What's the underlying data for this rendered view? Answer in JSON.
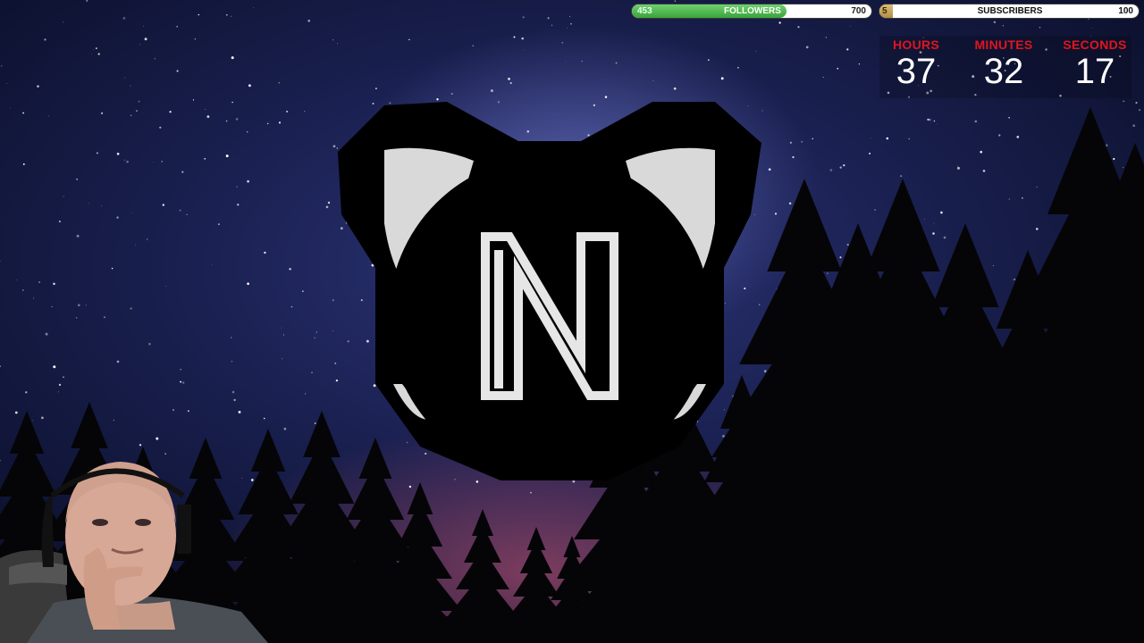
{
  "goals": {
    "followers": {
      "current": "453",
      "label": "FOLLOWERS",
      "target": "700",
      "progress": 0.647,
      "color": "#4cbb4c"
    },
    "subscribers": {
      "current": "5",
      "label": "SUBSCRIBERS",
      "target": "100",
      "progress": 0.05,
      "color": "#c9a55a"
    }
  },
  "countdown": {
    "hours_label": "HOURS",
    "hours": "37",
    "minutes_label": "MINUTES",
    "minutes": "32",
    "seconds_label": "SECONDS",
    "seconds": "17",
    "label_color": "#e0151e"
  },
  "logo": {
    "icon": "cat-ears-n-logo-icon"
  },
  "webcam": {
    "icon": "streamer-webcam"
  },
  "background": {
    "icon": "night-sky-milky-way-forest"
  }
}
